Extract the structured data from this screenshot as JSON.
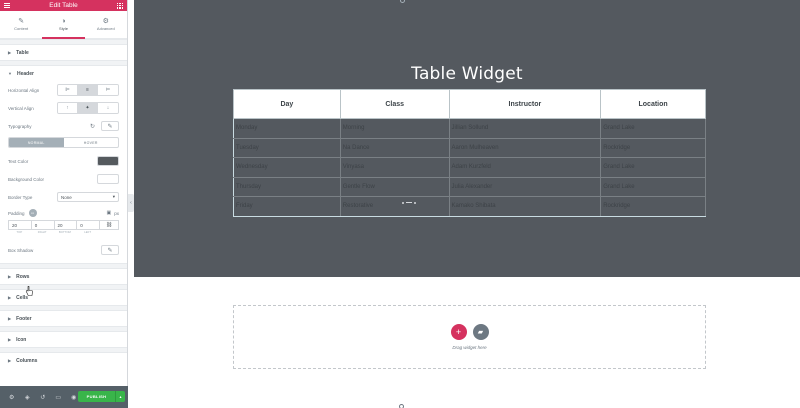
{
  "topbar": {
    "title": "Edit Table"
  },
  "tabs": [
    {
      "label": "Content",
      "icon": "pencil-icon"
    },
    {
      "label": "Style",
      "icon": "half-circle-icon"
    },
    {
      "label": "Advanced",
      "icon": "gear-icon"
    }
  ],
  "sections": {
    "table": "Table",
    "header": "Header",
    "rows": "Rows",
    "cells": "Cells",
    "footer": "Footer",
    "icon": "Icon",
    "columns": "Columns"
  },
  "header_controls": {
    "horizontal_align": "Horizontal Align",
    "vertical_align": "Vertical Align",
    "typography": "Typography",
    "normal_tab": "NORMAL",
    "hover_tab": "HOVER",
    "text_color": "Text Color",
    "text_color_value": "#555a5e",
    "background_color": "Background Color",
    "background_color_value": "#ffffff",
    "border_type": "Border Type",
    "border_type_value": "None",
    "padding": "Padding",
    "padding_unit": "px",
    "padding_values": {
      "top": "20",
      "right": "0",
      "bottom": "20",
      "left": "0"
    },
    "padding_labels": {
      "top": "Top",
      "right": "Right",
      "bottom": "Bottom",
      "left": "Left"
    },
    "box_shadow": "Box Shadow"
  },
  "footer": {
    "publish_label": "PUBLISH"
  },
  "preview": {
    "widget_title": "Table Widget",
    "columns": [
      "Day",
      "Class",
      "Instructor",
      "Location"
    ],
    "rows": [
      [
        "Monday",
        "Morning",
        "Jillian Sollund",
        "Grand Lake"
      ],
      [
        "Tuesday",
        "Na Dance",
        "Aaron Mulheaven",
        "Rockridge"
      ],
      [
        "Wednesday",
        "Vinyasa",
        "Adam Kurzfeld",
        "Grand Lake"
      ],
      [
        "Thursday",
        "Gentle Flow",
        "Julia Alexander",
        "Grand Lake"
      ],
      [
        "Friday",
        "Restorative",
        "Kamako Shibata",
        "Rockridge"
      ]
    ],
    "drop_text": "Drag widget here"
  },
  "colors": {
    "accent": "#d5325f",
    "dark_section": "#54595f",
    "publish": "#39b54a"
  }
}
